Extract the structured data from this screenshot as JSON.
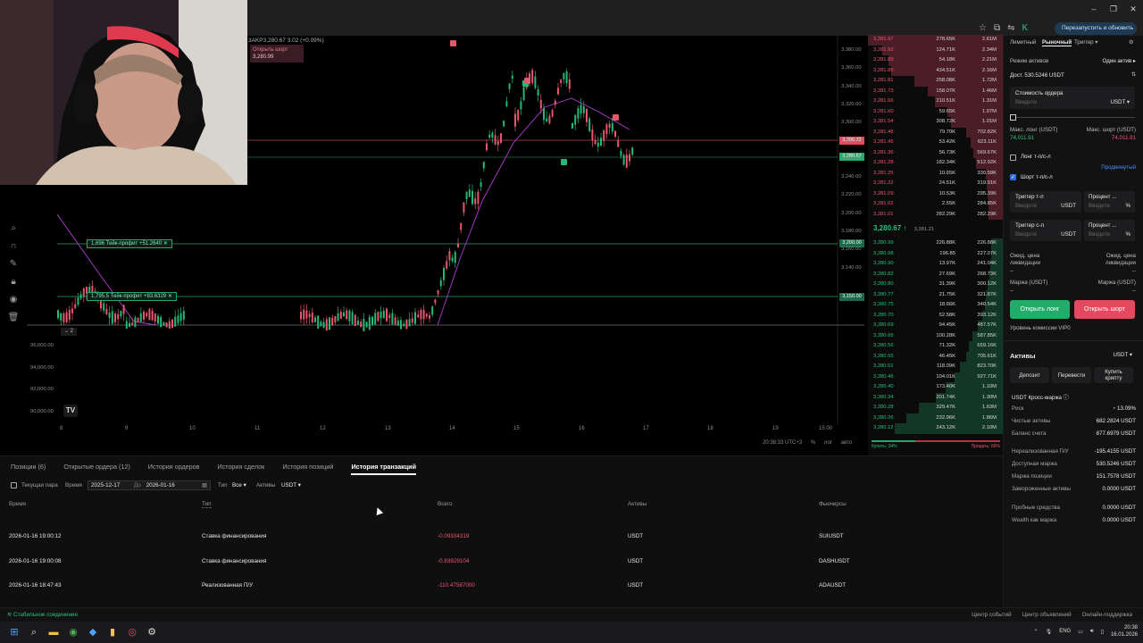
{
  "browser": {
    "update_label": "Перезапустить и обновить",
    "icons": [
      "star-icon",
      "extension-icon",
      "cast-icon",
      "profile-icon"
    ]
  },
  "window_controls": [
    "–",
    "❐",
    "✕"
  ],
  "chart": {
    "symbol_line": "3AKP3,280.67 3.02 (+0.09%)",
    "short_chip": {
      "label": "Открыть шорт",
      "price": "3,280.99"
    },
    "tp1": "1,696  Тейк-профит +51.2640",
    "tp2": "1,795.5  Тейк-профит +83.6329",
    "panel_badge": "⌄ 2",
    "tag_red": "3,296.72",
    "tag_green": "3,280.67",
    "tag_200": "3,200.00",
    "tag_150": "3,150.00",
    "y_labels_upper": [
      "3,380.00",
      "3,360.00",
      "3,340.00",
      "3,320.00",
      "3,300.00",
      "3,280.00",
      "3,260.00",
      "3,240.00",
      "3,220.00",
      "3,200.00",
      "3,180.00",
      "3,160.00",
      "3,140.00"
    ],
    "y_labels_lower": [
      "96,000.00",
      "94,000.00",
      "92,000.00",
      "90,000.00"
    ],
    "x_labels": [
      "8",
      "9",
      "10",
      "11",
      "12",
      "13",
      "14",
      "15",
      "16",
      "17",
      "18",
      "19",
      "15:00"
    ],
    "foot_time": "20:38:33 UTC+3",
    "foot_pct": "%",
    "foot_log": "лог",
    "foot_auto": "авто",
    "tv_logo": "TV"
  },
  "orderbook": {
    "asks": [
      [
        "3,281.97",
        "278.65K",
        "2.61M"
      ],
      [
        "3,281.93",
        "124.71K",
        "2.34M"
      ],
      [
        "3,281.89",
        "54.18K",
        "2.21M"
      ],
      [
        "3,281.85",
        "434.51K",
        "2.16M"
      ],
      [
        "3,281.81",
        "258.08K",
        "1.72M"
      ],
      [
        "3,281.73",
        "158.07K",
        "1.46M"
      ],
      [
        "3,281.66",
        "210.51K",
        "1.31M"
      ],
      [
        "3,281.60",
        "59.65K",
        "1.07M"
      ],
      [
        "3,281.54",
        "308.72K",
        "1.01M"
      ],
      [
        "3,281.48",
        "79.70K",
        "702.82K"
      ],
      [
        "3,281.45",
        "53.42K",
        "623.11K"
      ],
      [
        "3,281.36",
        "56.73K",
        "569.67K"
      ],
      [
        "3,281.28",
        "182.34K",
        "512.92K"
      ],
      [
        "3,281.25",
        "10.65K",
        "330.58K"
      ],
      [
        "3,281.22",
        "24.51K",
        "319.91K"
      ],
      [
        "3,281.09",
        "10.53K",
        "295.39K"
      ],
      [
        "3,281.02",
        "2.55K",
        "284.85K"
      ],
      [
        "3,281.01",
        "282.29K",
        "282.29K"
      ]
    ],
    "mid_price": "3,280.67",
    "mid_arrow": "↑",
    "mark_price": "3,281.21",
    "bids": [
      [
        "3,280.99",
        "226.88K",
        "226.88K"
      ],
      [
        "3,280.98",
        "196.85",
        "227.07K"
      ],
      [
        "3,280.90",
        "13.97K",
        "241.04K"
      ],
      [
        "3,280.82",
        "27.69K",
        "268.73K"
      ],
      [
        "3,280.80",
        "31.39K",
        "300.12K"
      ],
      [
        "3,280.77",
        "21.75K",
        "321.87K"
      ],
      [
        "3,280.75",
        "18.66K",
        "340.54K"
      ],
      [
        "3,280.70",
        "52.58K",
        "393.12K"
      ],
      [
        "3,280.69",
        "94.45K",
        "487.57K"
      ],
      [
        "3,280.65",
        "100.28K",
        "587.85K"
      ],
      [
        "3,280.56",
        "71.32K",
        "659.16K"
      ],
      [
        "3,280.55",
        "46.45K",
        "705.61K"
      ],
      [
        "3,280.51",
        "118.09K",
        "823.70K"
      ],
      [
        "3,280.46",
        "104.01K",
        "927.71K"
      ],
      [
        "3,280.40",
        "173.40K",
        "1.10M"
      ],
      [
        "3,280.34",
        "201.74K",
        "1.30M"
      ],
      [
        "3,280.28",
        "329.47K",
        "1.63M"
      ],
      [
        "3,280.26",
        "232.96K",
        "1.86M"
      ],
      [
        "3,280.12",
        "243.12K",
        "2.10M"
      ]
    ],
    "buy_label": "Купить: 34%",
    "sell_label": "Продать: 66%",
    "buy_ratio": 0.34
  },
  "order_panel": {
    "tabs": [
      "Лимитный",
      "Рыночный",
      "Триггер ▾"
    ],
    "margin_mode": "Один актив ▸",
    "margin_mode_label": "Режим активов",
    "available": "Дост. 530.5246 USDT",
    "cost_label": "Стоимость ордера",
    "cost_placeholder": "Введите",
    "cost_unit": "USDT ▾",
    "max_long_label": "Макс. лонг (USDT)",
    "max_long": "74,011.91",
    "max_short_label": "Макс. шорт (USDT)",
    "max_short": "74,011.91",
    "long_tpsl": "Лонг т-п/с-л",
    "advanced": "Продвинутый",
    "short_tpsl": "Шорт т-п/с-л",
    "tp_label": "Триггер т-п",
    "tp_pct": "Процент ...",
    "sl_label": "Триггер с-л",
    "sl_pct": "Процент ...",
    "placeholder": "Введите",
    "unit": "USDT",
    "pct": "%",
    "liq_left": "Ожид. цена ликвидации",
    "liq_right": "Ожид. цена ликвидации",
    "liq_val": "--",
    "margin_left": "Маржа (USDT)",
    "margin_right": "Маржа (USDT)",
    "margin_val": "--",
    "open_long": "Открыть лонг",
    "open_short": "Открыть шорт",
    "fee_level": "Уровень комиссии VIP0",
    "assets_title": "Активы",
    "assets_unit": "USDT ▾",
    "deposit": "Депозит",
    "transfer": "Перевести",
    "buy_crypto": "Купить крипту",
    "cross_margin": "USDT Кросс-маржа ⓘ",
    "risk_label": "Риск",
    "risk_val": "13.09%",
    "rows": [
      [
        "Чистые активы",
        "682.2824 USDT"
      ],
      [
        "Баланс счета",
        "877.6979 USDT"
      ],
      [
        "Нереализованная П/У",
        "-195.4155 USDT"
      ],
      [
        "Доступная маржа",
        "530.5246 USDT"
      ],
      [
        "Маржа позиции",
        "151.7578 USDT"
      ],
      [
        "Замороженные активы",
        "0.0000 USDT"
      ],
      [
        "Пробные средства",
        "0.0000 USDT"
      ],
      [
        "Wealth как маржа",
        "0.0000 USDT"
      ]
    ]
  },
  "bottom": {
    "tabs": [
      "Позиции (6)",
      "Открытые ордера (12)",
      "История ордеров",
      "История сделок",
      "История позиций",
      "История транзакций"
    ],
    "current_pair": "Текущая пара",
    "time_label": "Время",
    "date_from": "2025-12-17",
    "date_sep": "До",
    "date_to": "2026-01-16",
    "type_label": "Тип",
    "type_value": "Все ▾",
    "assets_label": "Активы",
    "assets_value": "USDT ▾",
    "headers": [
      "Время",
      "Тип",
      "Всего",
      "Активы",
      "Фьючерсы"
    ],
    "rows": [
      [
        "2026-01-16 19:00:12",
        "Ставка финансирования",
        "-0.09334319",
        "USDT",
        "SUIUSDT"
      ],
      [
        "2026-01-16 19:00:08",
        "Ставка финансирования",
        "-0.83929104",
        "USDT",
        "DASHUSDT"
      ],
      [
        "2026-01-16 18:47:43",
        "Реализованная П/У",
        "-110.47587000",
        "USDT",
        "ADAUSDT"
      ]
    ]
  },
  "status": {
    "connection": "Стабильное соединение",
    "links": [
      "Центр событий",
      "Центр объявлений",
      "Онлайн-поддержка"
    ]
  },
  "taskbar": {
    "lang": "ENG",
    "time": "20:38",
    "date": "16.01.2026"
  }
}
